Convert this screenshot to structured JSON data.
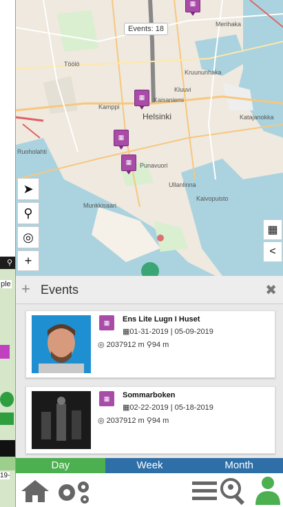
{
  "background_app": {
    "partial_label": "ple",
    "partial_date": "19-"
  },
  "map": {
    "events_count": "Events: 18",
    "places": {
      "helsinki": "Helsinki",
      "kaisaniemi": "Kaisaniemi",
      "kruununhaka": "Kruununhaka",
      "merihaka": "Merihaka",
      "katajanokka": "Katajanokka",
      "kamppi": "Kamppi",
      "punavuori": "Punavuori",
      "ullanlinna": "Ullanlinna",
      "kaivopuisto": "Kaivopuisto",
      "ruoholahti": "Ruoholahti",
      "munkkisaari": "Munkkisaari",
      "toolo": "Töölö",
      "kluuvi": "Kluuvi"
    },
    "controls": {
      "locate": "➤",
      "pin": "⚲",
      "target": "◎",
      "zoom_in": "+",
      "calendar": "▦",
      "share": "<"
    }
  },
  "events_panel": {
    "title": "Events",
    "add_icon": "+",
    "close_icon": "✖",
    "items": [
      {
        "title": "Ens Lite Lugn I Huset",
        "dates": "01-31-2019 | 05-09-2019",
        "distance": "2037912 m",
        "walk": "94 m"
      },
      {
        "title": "Sommarboken",
        "dates": "02-22-2019 | 05-18-2019",
        "distance": "2037912 m",
        "walk": "94 m"
      }
    ]
  },
  "tabs": {
    "day": "Day",
    "week": "Week",
    "month": "Month"
  },
  "colors": {
    "marker": "#a84ca8",
    "day_tab": "#4caf50",
    "week_tab": "#2f6fa8",
    "user_icon": "#4caf50"
  }
}
